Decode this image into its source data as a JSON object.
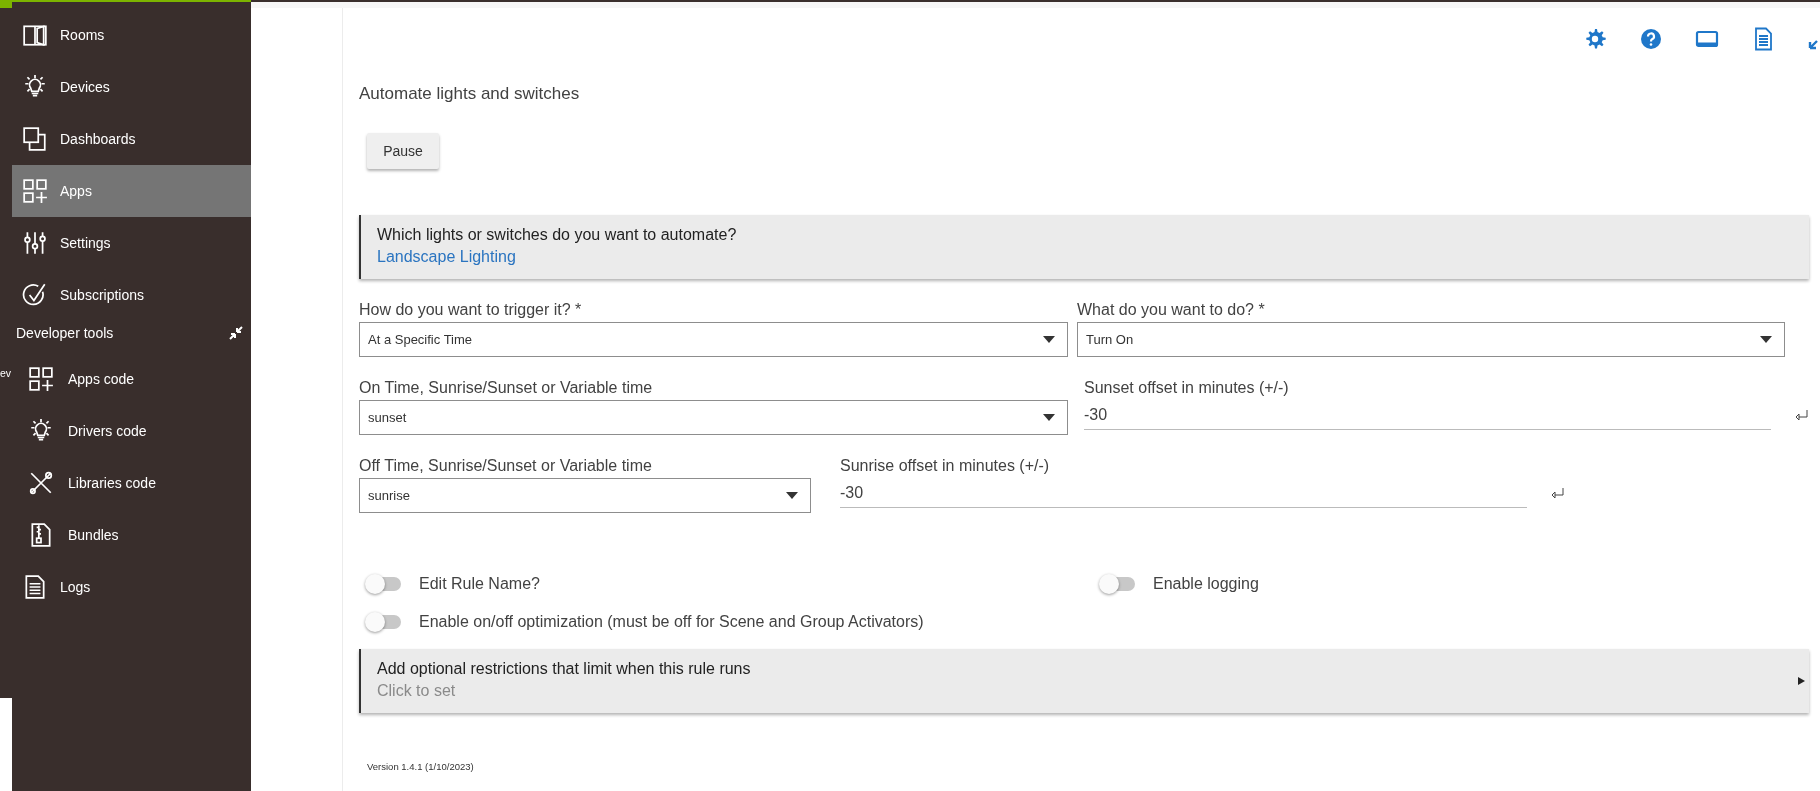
{
  "collapsed_sidebar": {
    "label": "ev"
  },
  "sidebar": {
    "items": [
      {
        "kind": "link",
        "label": "Rooms",
        "selected": false
      },
      {
        "kind": "link",
        "label": "Devices",
        "selected": false
      },
      {
        "kind": "link",
        "label": "Dashboards",
        "selected": false
      },
      {
        "kind": "link",
        "label": "Apps",
        "selected": true
      },
      {
        "kind": "link",
        "label": "Settings",
        "selected": false
      },
      {
        "kind": "link",
        "label": "Subscriptions",
        "selected": false
      },
      {
        "kind": "group",
        "label": "Developer tools",
        "expanded": true,
        "children": [
          {
            "label": "Apps code",
            "selected": false
          },
          {
            "label": "Drivers code",
            "selected": false
          },
          {
            "label": "Libraries code",
            "selected": false
          },
          {
            "label": "Bundles",
            "selected": false
          }
        ]
      },
      {
        "kind": "link",
        "label": "Logs",
        "selected": false
      }
    ]
  },
  "page": {
    "title": "Automate lights and switches",
    "pause_button": "Pause",
    "devices_section": {
      "title": "Which lights or switches do you want to automate?",
      "value": "Landscape Lighting"
    },
    "rows": [
      [
        {
          "kind": "select",
          "label": "How do you want to trigger it? *",
          "value": "At a Specific Time"
        },
        {
          "kind": "select",
          "label": "What do you want to do? *",
          "value": "Turn On"
        }
      ],
      [
        {
          "kind": "select",
          "label": "On Time, Sunrise/Sunset or Variable time",
          "value": "sunset"
        },
        {
          "kind": "number",
          "label": "Sunset offset in minutes (+/-)",
          "value": "-30"
        }
      ],
      [
        {
          "kind": "select",
          "label": "Off Time, Sunrise/Sunset or Variable time",
          "value": "sunrise"
        },
        {
          "kind": "number",
          "label": "Sunrise offset in minutes (+/-)",
          "value": "-30"
        }
      ]
    ],
    "toggles": [
      {
        "label": "Edit Rule Name?",
        "on": false
      },
      {
        "label": "Enable logging",
        "on": false
      },
      {
        "label": "Enable on/off optimization (must be off for Scene and Group Activators)",
        "on": false
      }
    ],
    "restrictions_section": {
      "title": "Add optional restrictions that limit when this rule runs",
      "hint": "Click to set"
    },
    "version": "Version 1.4.1 (1/10/2023)"
  }
}
